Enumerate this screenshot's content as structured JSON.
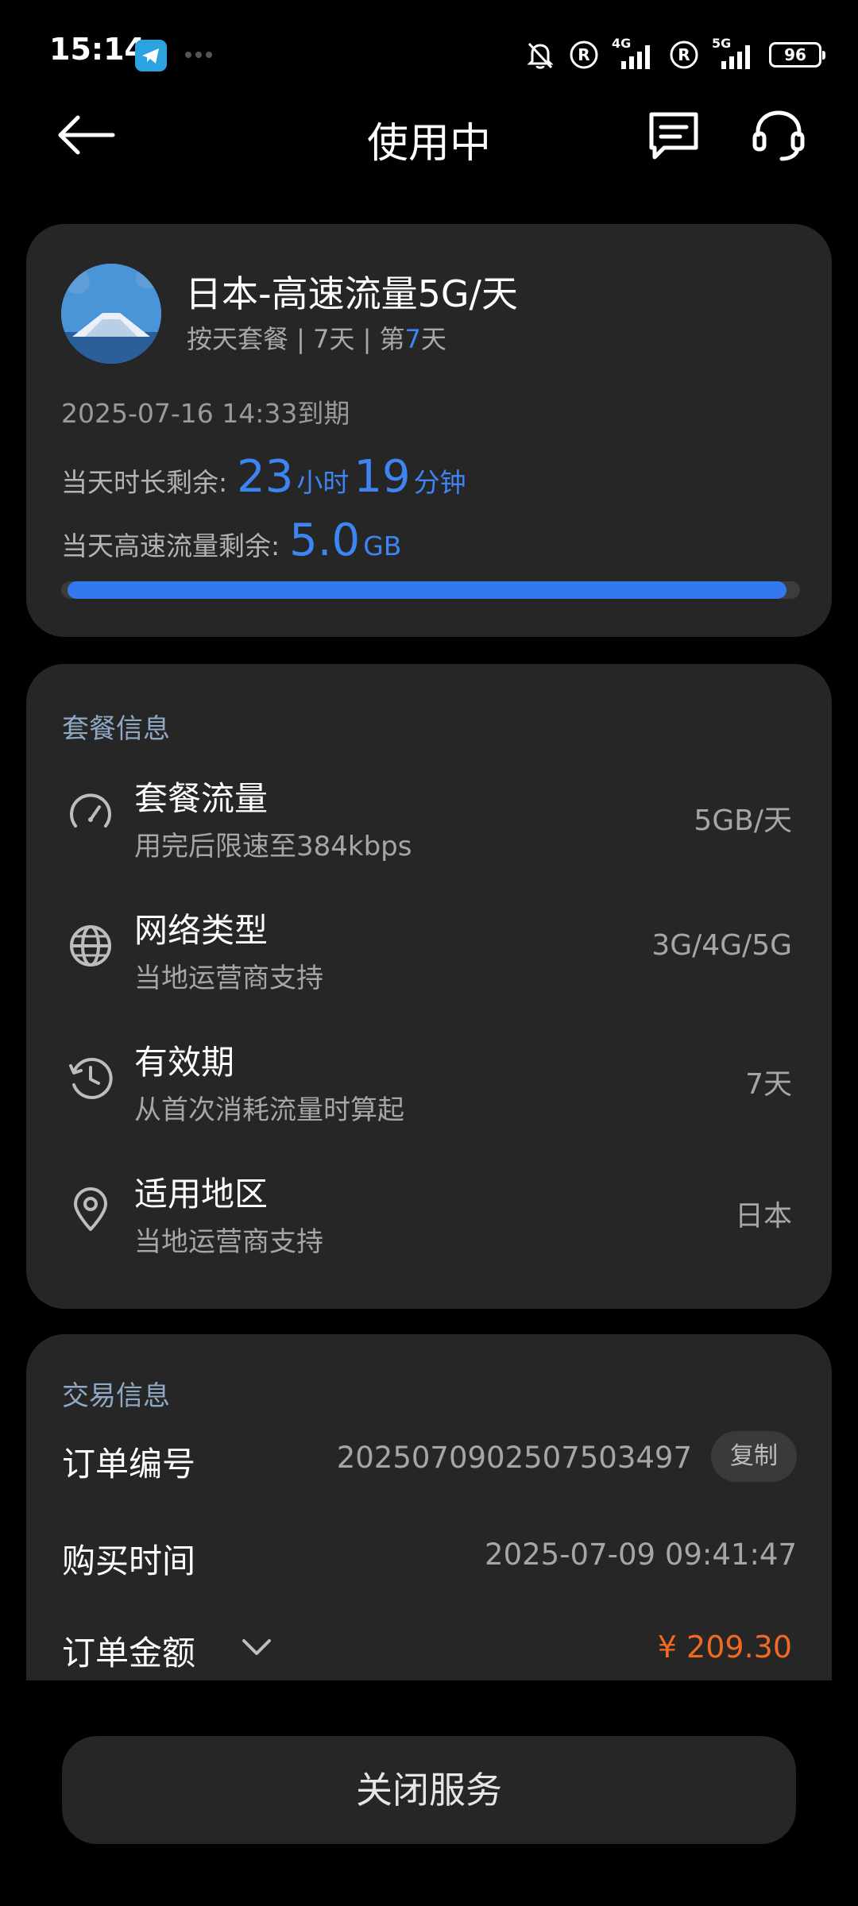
{
  "status_bar": {
    "time": "15:14",
    "battery": "96",
    "net1": "4G",
    "net2": "5G"
  },
  "header": {
    "title": "使用中"
  },
  "usage": {
    "plan_name": "日本-高速流量5G/天",
    "plan_sub_prefix": "按天套餐 | 7天 | 第",
    "plan_sub_day": "7",
    "plan_sub_suffix": "天",
    "expire": "2025-07-16 14:33到期",
    "time_label": "当天时长剩余:",
    "hours": "23",
    "hours_unit": "小时",
    "minutes": "19",
    "minutes_unit": "分钟",
    "data_label": "当天高速流量剩余:",
    "data_value": "5.0",
    "data_unit": "GB",
    "data_remaining_fraction": 0.99,
    "accent_color": "#3d85f2"
  },
  "plan_info": {
    "title": "套餐信息",
    "items": [
      {
        "icon": "speedometer-icon",
        "title": "套餐流量",
        "desc": "用完后限速至384kbps",
        "value": "5GB/天"
      },
      {
        "icon": "globe-icon",
        "title": "网络类型",
        "desc": "当地运营商支持",
        "value": "3G/4G/5G"
      },
      {
        "icon": "clock-history-icon",
        "title": "有效期",
        "desc": "从首次消耗流量时算起",
        "value": "7天"
      },
      {
        "icon": "location-pin-icon",
        "title": "适用地区",
        "desc": "当地运营商支持",
        "value": "日本"
      }
    ]
  },
  "trade_info": {
    "title": "交易信息",
    "order_label": "订单编号",
    "order_no": "2025070902507503497",
    "copy_label": "复制",
    "time_label": "购买时间",
    "time_value": "2025-07-09 09:41:47",
    "amount_label": "订单金额",
    "amount_value": "¥ 209.30",
    "amount_color": "#f26a21"
  },
  "actions": {
    "close_label": "关闭服务"
  }
}
